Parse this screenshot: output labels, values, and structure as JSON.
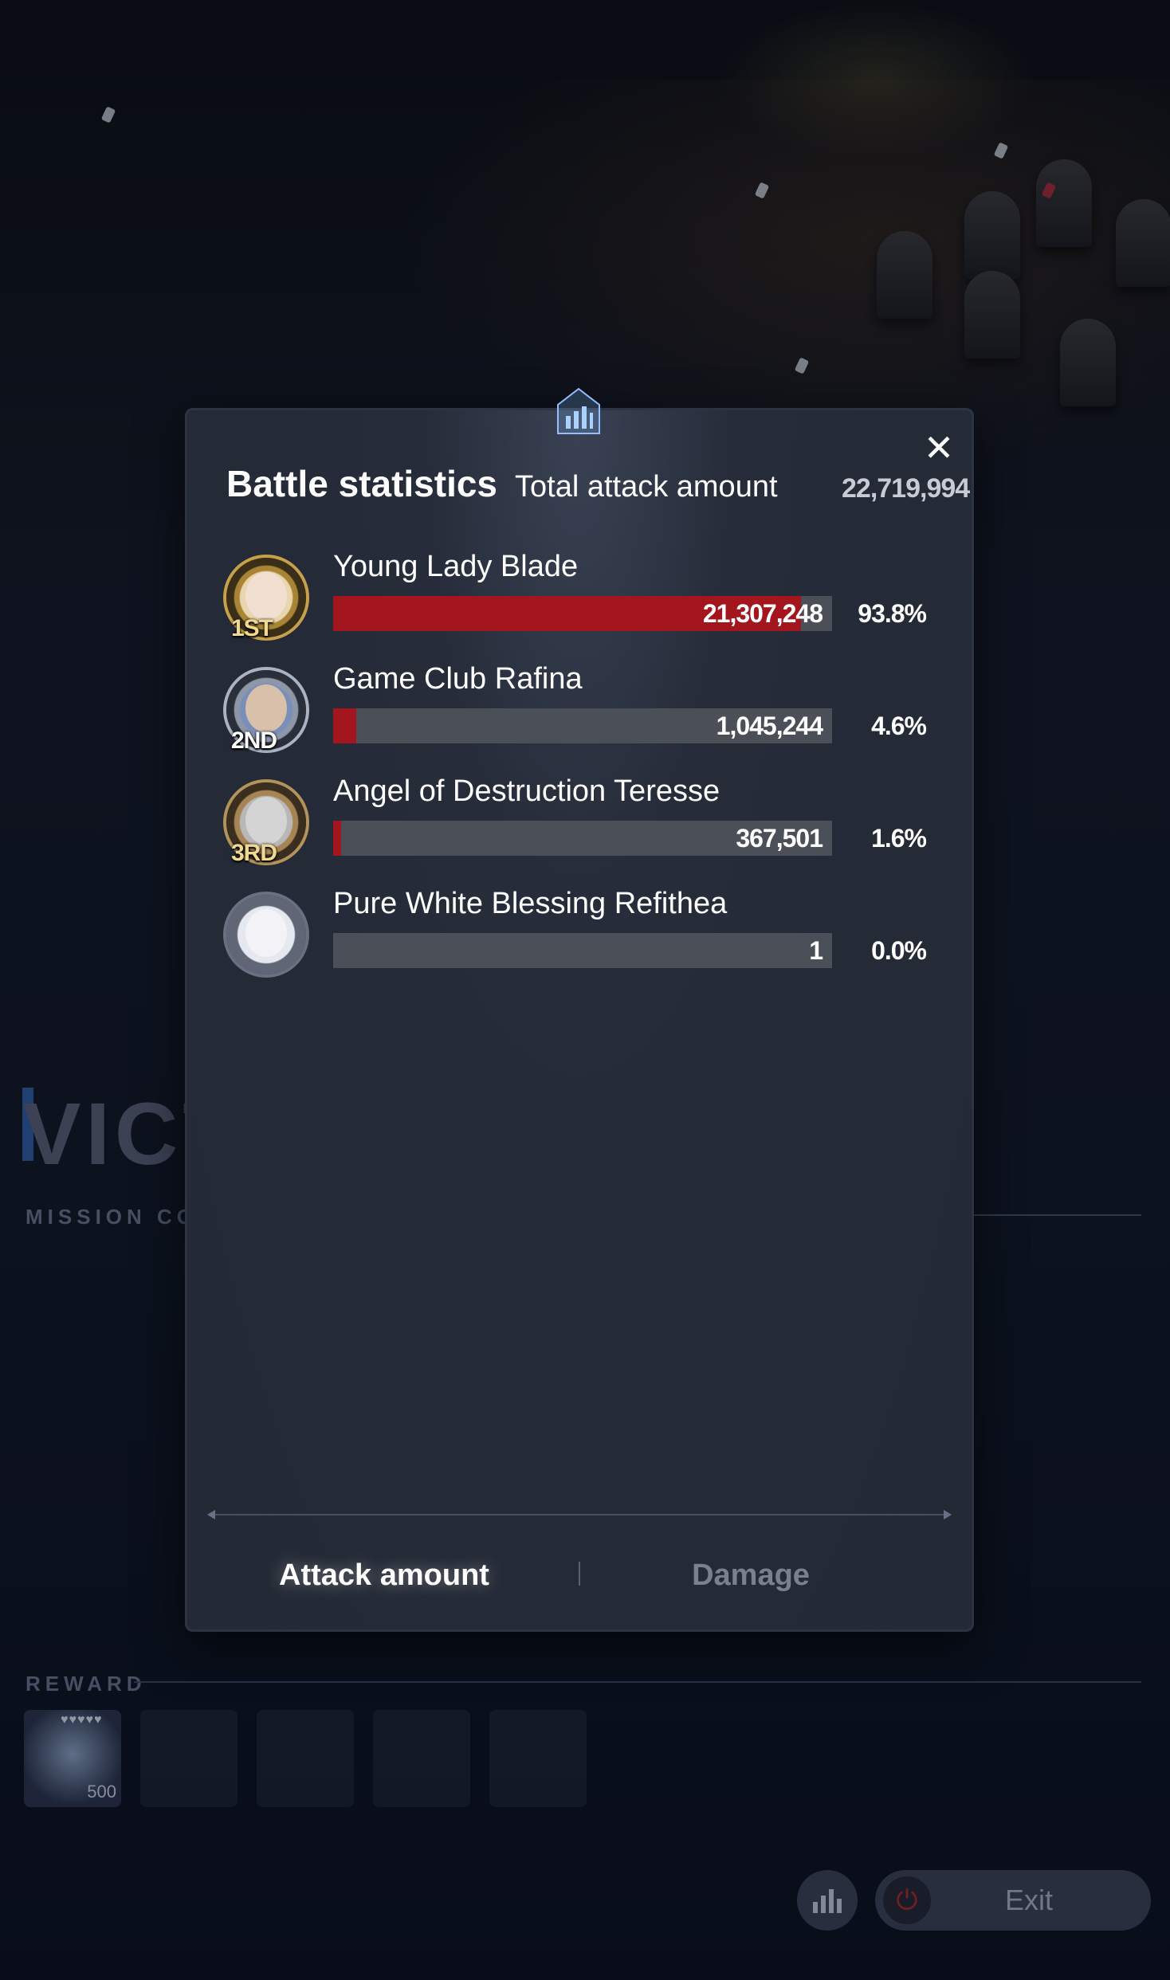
{
  "background": {
    "victory_text": "VICTO",
    "mission_text": "MISSION COMI",
    "reward_label": "REWARD",
    "reward_quantity": "500",
    "reward_gems": "♥♥♥♥♥",
    "exit_label": "Exit"
  },
  "modal": {
    "title": "Battle statistics",
    "total_label": "Total attack amount",
    "total_value": "22,719,994",
    "close_glyph": "✕",
    "rows": [
      {
        "rank": "1ST",
        "name": "Young Lady Blade",
        "value": "21,307,248",
        "percent": "93.8%",
        "fraction": 0.938
      },
      {
        "rank": "2ND",
        "name": "Game Club Rafina",
        "value": "1,045,244",
        "percent": "4.6%",
        "fraction": 0.046
      },
      {
        "rank": "3RD",
        "name": "Angel of Destruction Teresse",
        "value": "367,501",
        "percent": "1.6%",
        "fraction": 0.016
      },
      {
        "rank": "",
        "name": "Pure White Blessing Refithea",
        "value": "1",
        "percent": "0.0%",
        "fraction": 0.0
      }
    ],
    "tabs": {
      "attack": "Attack amount",
      "damage": "Damage"
    }
  },
  "colors": {
    "bar_fill": "#a3161e",
    "bar_track": "#4b4f58",
    "modal_bg": "#242a36"
  }
}
